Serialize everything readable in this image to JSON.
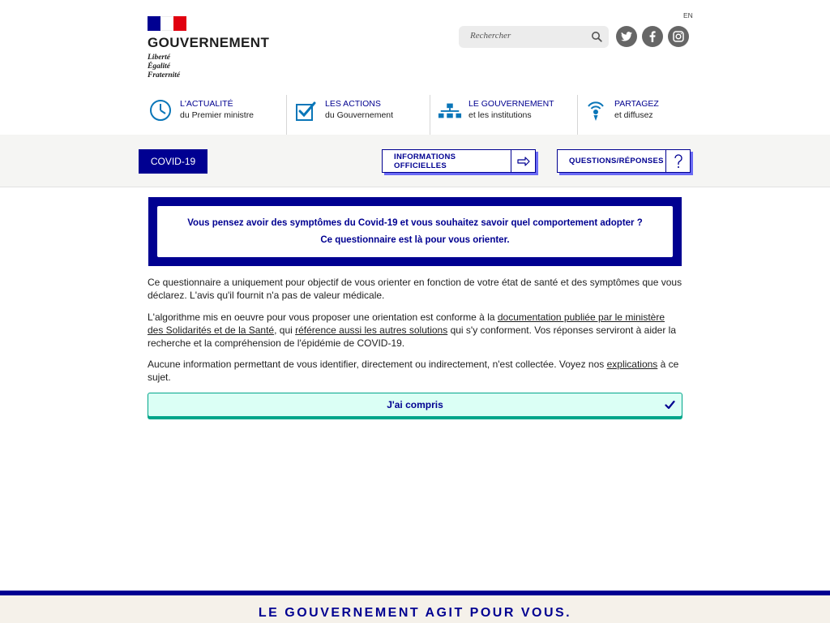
{
  "header": {
    "logo_title": "GOUVERNEMENT",
    "motto": [
      "Liberté",
      "Égalité",
      "Fraternité"
    ],
    "lang": "EN",
    "search_placeholder": "Rechercher"
  },
  "social": [
    "twitter-icon",
    "facebook-icon",
    "instagram-icon"
  ],
  "nav": [
    {
      "title": "L'ACTUALITÉ",
      "sub": "du Premier ministre"
    },
    {
      "title": "LES ACTIONS",
      "sub": "du Gouvernement"
    },
    {
      "title": "LE GOUVERNEMENT",
      "sub": "et les institutions"
    },
    {
      "title": "PARTAGEZ",
      "sub": "et diffusez"
    }
  ],
  "band": {
    "covid_tab": "COVID-19",
    "info_btn": "INFORMATIONS OFFICIELLES",
    "qr_btn": "QUESTIONS/RÉPONSES"
  },
  "alert": {
    "line1": "Vous pensez avoir des symptômes du Covid-19 et vous souhaitez savoir quel comportement adopter ?",
    "line2": "Ce questionnaire est là pour vous orienter."
  },
  "body": {
    "p1": "Ce questionnaire a uniquement pour objectif de vous orienter en fonction de votre état de santé et des symptômes que vous déclarez. L'avis qu'il fournit n'a pas de valeur médicale.",
    "p2_a": "L'algorithme mis en oeuvre pour vous proposer une orientation est conforme à la ",
    "p2_link1": "documentation publiée par le ministère des Solidarités et de la Santé",
    "p2_b": ", qui ",
    "p2_link2": "référence aussi les autres solutions",
    "p2_c": " qui s'y conforment. Vos réponses serviront à aider la recherche et la compréhension de l'épidémie de COVID-19.",
    "p3_a": "Aucune information permettant de vous identifier, directement ou indirectement, n'est collectée. Voyez nos ",
    "p3_link": "explications",
    "p3_b": " à ce sujet."
  },
  "ok_button": "J'ai compris",
  "footer": "LE GOUVERNEMENT AGIT POUR VOUS.",
  "colors": {
    "primary": "#000091",
    "accent_red": "#e1000f",
    "ok_bg": "#dbfff5",
    "ok_border": "#00a58a"
  }
}
